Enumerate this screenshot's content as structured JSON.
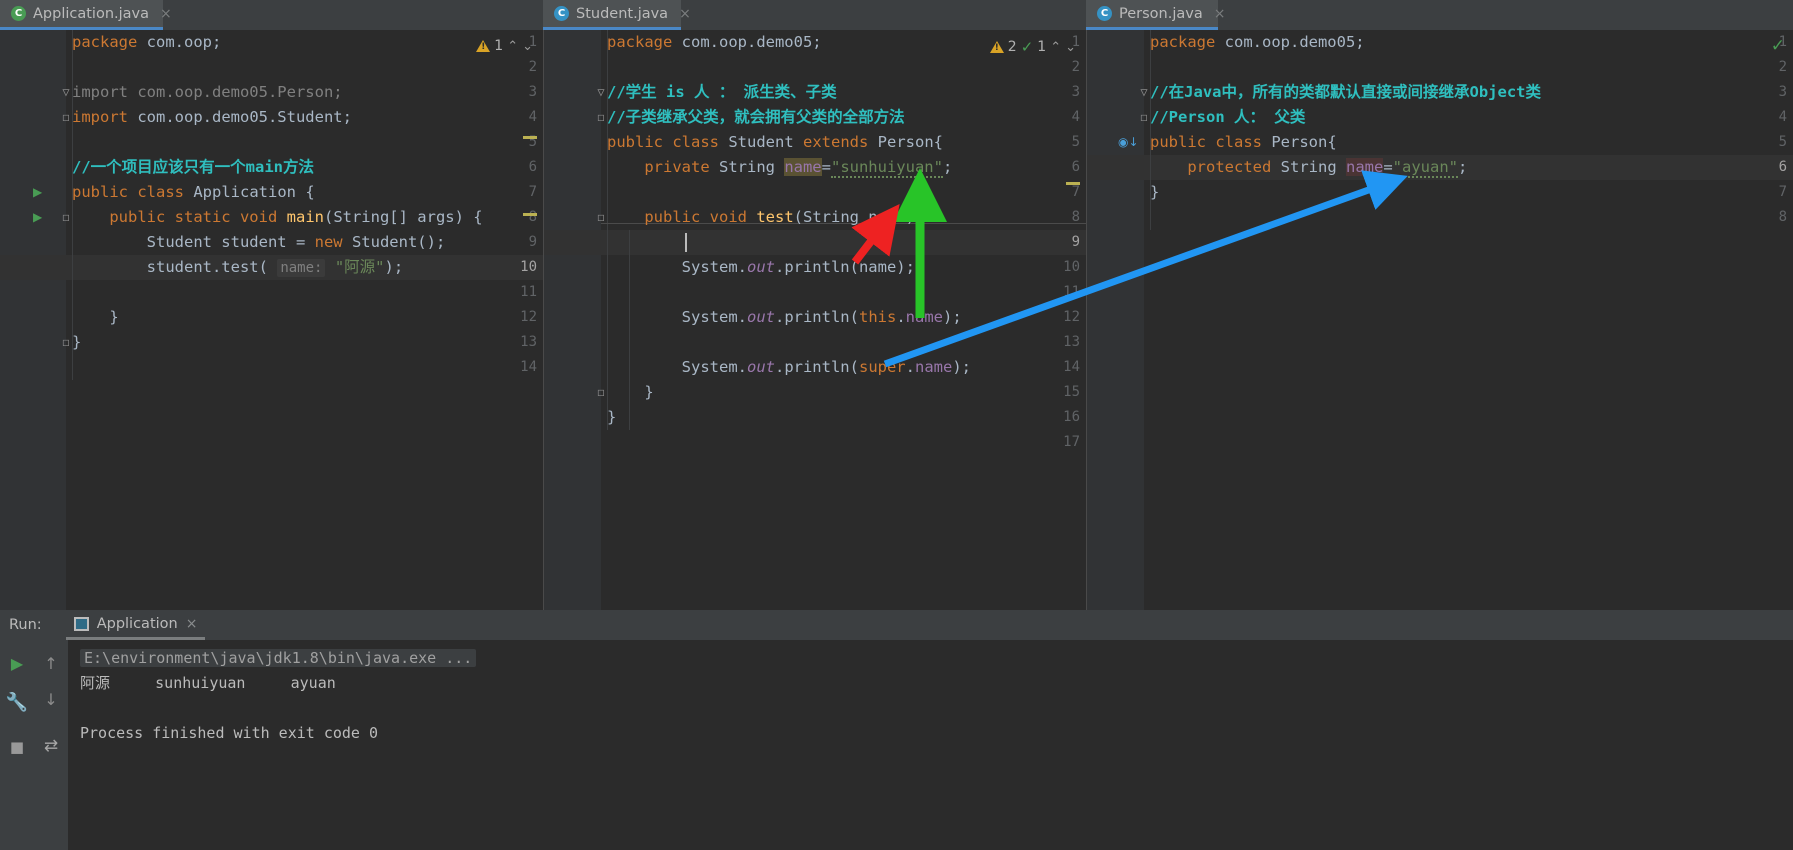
{
  "tabs": [
    {
      "name": "Application.java",
      "icon": "java-class-green-icon",
      "close": "×",
      "active": true
    },
    {
      "name": "Student.java",
      "icon": "java-class-blue-icon",
      "close": "×",
      "active": true
    },
    {
      "name": "Person.java",
      "icon": "java-class-blue-icon",
      "close": "×",
      "active": true
    }
  ],
  "editors": {
    "application": {
      "filename": "Application.java",
      "inspection": {
        "warning_count": "1",
        "up": "⌃",
        "down": "⌄"
      },
      "lines": [
        {
          "n": "1",
          "text": "package com.oop;"
        },
        {
          "n": "2",
          "text": ""
        },
        {
          "n": "3",
          "text": "import com.oop.demo05.Person;"
        },
        {
          "n": "4",
          "text": "import com.oop.demo05.Student;"
        },
        {
          "n": "5",
          "text": ""
        },
        {
          "n": "6",
          "text": "//一个项目应该只有一个main方法"
        },
        {
          "n": "7",
          "text": "public class Application {"
        },
        {
          "n": "8",
          "text": "    public static void main(String[] args) {"
        },
        {
          "n": "9",
          "text": "        Student student = new Student();"
        },
        {
          "n": "10",
          "text": "        student.test( name: \"阿源\");"
        },
        {
          "n": "11",
          "text": ""
        },
        {
          "n": "12",
          "text": "    }"
        },
        {
          "n": "13",
          "text": "}"
        },
        {
          "n": "14",
          "text": ""
        }
      ]
    },
    "student": {
      "filename": "Student.java",
      "inspection": {
        "warning_count": "2",
        "check_count": "1",
        "up": "⌃",
        "down": "⌄"
      },
      "lines": [
        {
          "n": "1",
          "text": "package com.oop.demo05;"
        },
        {
          "n": "2",
          "text": ""
        },
        {
          "n": "3",
          "text": "//学生 is 人 ： 派生类、子类"
        },
        {
          "n": "4",
          "text": "//子类继承父类，就会拥有父类的全部方法"
        },
        {
          "n": "5",
          "text": "public class Student extends Person{"
        },
        {
          "n": "6",
          "text": "    private String name=\"sunhuiyuan\";"
        },
        {
          "n": "7",
          "text": ""
        },
        {
          "n": "8",
          "text": "    public void test(String name){"
        },
        {
          "n": "9",
          "text": ""
        },
        {
          "n": "10",
          "text": "        System.out.println(name);"
        },
        {
          "n": "11",
          "text": ""
        },
        {
          "n": "12",
          "text": "        System.out.println(this.name);"
        },
        {
          "n": "13",
          "text": ""
        },
        {
          "n": "14",
          "text": "        System.out.println(super.name);"
        },
        {
          "n": "15",
          "text": "    }"
        },
        {
          "n": "16",
          "text": "}"
        },
        {
          "n": "17",
          "text": ""
        }
      ]
    },
    "person": {
      "filename": "Person.java",
      "inspection": {
        "check": "✓"
      },
      "lines": [
        {
          "n": "1",
          "text": "package com.oop.demo05;"
        },
        {
          "n": "2",
          "text": ""
        },
        {
          "n": "3",
          "text": "//在Java中，所有的类都默认直接或间接继承Object类"
        },
        {
          "n": "4",
          "text": "//Person 人： 父类"
        },
        {
          "n": "5",
          "text": "public class Person{"
        },
        {
          "n": "6",
          "text": "    protected String name=\"ayuan\";"
        },
        {
          "n": "7",
          "text": "}"
        },
        {
          "n": "8",
          "text": ""
        }
      ]
    }
  },
  "run_panel": {
    "label": "Run:",
    "tab_name": "Application",
    "tab_close": "×",
    "toolbar": {
      "run": "▶",
      "wrench": "ὒ7",
      "stop": "■",
      "up": "↑",
      "down": "↓",
      "softwrap": "↵"
    },
    "console_lines": [
      {
        "text": "E:\\environment\\java\\jdk1.8\\bin\\java.exe ...",
        "kind": "command"
      },
      {
        "text": "阿源     sunhuiyuan     ayuan",
        "kind": "output"
      },
      {
        "text": "",
        "kind": "output"
      },
      {
        "text": "Process finished with exit code 0",
        "kind": "output"
      }
    ]
  },
  "annotations": {
    "arrows": [
      {
        "name": "green-arrow-field-init",
        "color": "#28c428",
        "from": "line9-test-body",
        "to": "sunhuiyuan-string"
      },
      {
        "name": "red-arrow-parameter",
        "color": "#ee2222",
        "from": "below-param",
        "to": "test-method-parameter-name"
      },
      {
        "name": "blue-arrow-super-field",
        "color": "#2196f3",
        "from": "super-name-usage",
        "to": "person-ayuan-field"
      }
    ]
  },
  "colors": {
    "editor_bg": "#2b2b2b",
    "gutter_bg": "#313335",
    "chrome_bg": "#3c3f41",
    "tab_active": "#4e5254",
    "accent_blue": "#4a88c7",
    "comment_teal": "#2fbfbf",
    "keyword_orange": "#cc7832",
    "string_green": "#6a8759",
    "field_purple": "#9876aa"
  }
}
